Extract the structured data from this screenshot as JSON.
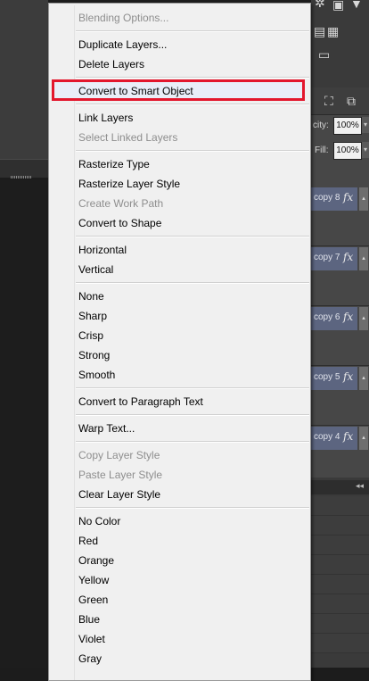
{
  "menu": {
    "items": [
      {
        "label": "Blending Options...",
        "enabled": false
      },
      {
        "label": "Duplicate Layers...",
        "enabled": true
      },
      {
        "label": "Delete Layers",
        "enabled": true
      },
      {
        "label": "Convert to Smart Object",
        "enabled": true,
        "highlighted": true
      },
      {
        "label": "Link Layers",
        "enabled": true
      },
      {
        "label": "Select Linked Layers",
        "enabled": false
      },
      {
        "label": "Rasterize Type",
        "enabled": true
      },
      {
        "label": "Rasterize Layer Style",
        "enabled": true
      },
      {
        "label": "Create Work Path",
        "enabled": false
      },
      {
        "label": "Convert to Shape",
        "enabled": true
      },
      {
        "label": "Horizontal",
        "enabled": true
      },
      {
        "label": "Vertical",
        "enabled": true
      },
      {
        "label": "None",
        "enabled": true
      },
      {
        "label": "Sharp",
        "enabled": true
      },
      {
        "label": "Crisp",
        "enabled": true
      },
      {
        "label": "Strong",
        "enabled": true
      },
      {
        "label": "Smooth",
        "enabled": true
      },
      {
        "label": "Convert to Paragraph Text",
        "enabled": true
      },
      {
        "label": "Warp Text...",
        "enabled": true
      },
      {
        "label": "Copy Layer Style",
        "enabled": false
      },
      {
        "label": "Paste Layer Style",
        "enabled": false
      },
      {
        "label": "Clear Layer Style",
        "enabled": true
      },
      {
        "label": "No Color",
        "enabled": true
      },
      {
        "label": "Red",
        "enabled": true
      },
      {
        "label": "Orange",
        "enabled": true
      },
      {
        "label": "Yellow",
        "enabled": true
      },
      {
        "label": "Green",
        "enabled": true
      },
      {
        "label": "Blue",
        "enabled": true
      },
      {
        "label": "Violet",
        "enabled": true
      },
      {
        "label": "Gray",
        "enabled": true
      }
    ],
    "highlight_color": "#e3172d"
  },
  "layers_panel": {
    "opacity_label": "city:",
    "opacity_value": "100%",
    "fill_label": "Fill:",
    "fill_value": "100%",
    "layers": [
      {
        "name": "copy 8",
        "fx": "fx"
      },
      {
        "name": "copy 7",
        "fx": "fx"
      },
      {
        "name": "copy 6",
        "fx": "fx"
      },
      {
        "name": "copy 5",
        "fx": "fx"
      },
      {
        "name": "copy 4",
        "fx": "fx"
      }
    ],
    "collapse_glyph": "◂◂"
  }
}
